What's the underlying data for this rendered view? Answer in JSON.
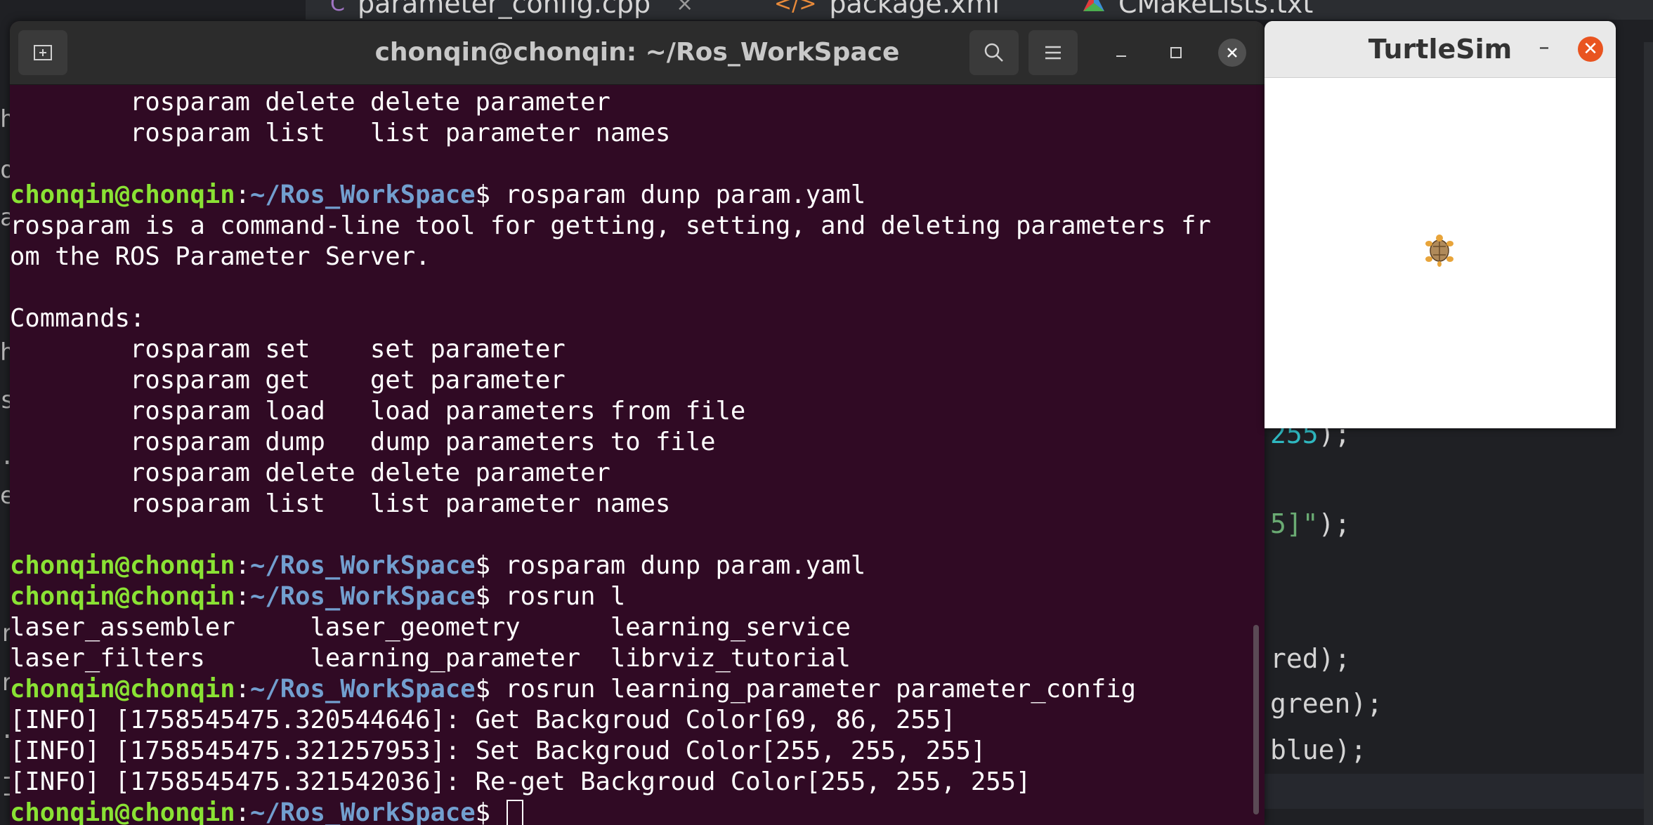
{
  "editor": {
    "tabs": [
      {
        "label": "parameter_config.cpp",
        "icon": "cpp-file-icon"
      },
      {
        "label": "package.xml",
        "icon": "xml-file-icon"
      },
      {
        "label": "CMakeLists.txt",
        "icon": "cmake-icon"
      }
    ],
    "tab_close": "×",
    "code_fragments": [
      {
        "text": "255",
        "tail": ");"
      },
      {
        "text": "5]\"",
        "tail": ");"
      },
      {
        "text": "red);"
      },
      {
        "text": "green);"
      },
      {
        "text": "blue);"
      }
    ],
    "gutter_glyphs": [
      "h",
      "o",
      "a",
      "h",
      "s",
      ".",
      "e",
      "r",
      "r",
      ".",
      "-",
      "-"
    ]
  },
  "terminal": {
    "title": "chonqin@chonqin: ~/Ros_WorkSpace",
    "prompt_user": "chonqin@chonqin",
    "prompt_sep": ":",
    "prompt_path": "~/Ros_WorkSpace",
    "prompt_end": "$",
    "lines": [
      {
        "text": "        rosparam delete delete parameter"
      },
      {
        "text": "        rosparam list   list parameter names"
      },
      {
        "text": ""
      },
      {
        "prompt": true,
        "cmd": " rosparam dunp param.yaml"
      },
      {
        "text": "rosparam is a command-line tool for getting, setting, and deleting parameters fr"
      },
      {
        "text": "om the ROS Parameter Server."
      },
      {
        "text": ""
      },
      {
        "text": "Commands:"
      },
      {
        "text": "        rosparam set    set parameter"
      },
      {
        "text": "        rosparam get    get parameter"
      },
      {
        "text": "        rosparam load   load parameters from file"
      },
      {
        "text": "        rosparam dump   dump parameters to file"
      },
      {
        "text": "        rosparam delete delete parameter"
      },
      {
        "text": "        rosparam list   list parameter names"
      },
      {
        "text": ""
      },
      {
        "prompt": true,
        "cmd": " rosparam dunp param.yaml"
      },
      {
        "prompt": true,
        "cmd": " rosrun l"
      },
      {
        "text": "laser_assembler     laser_geometry      learning_service"
      },
      {
        "text": "laser_filters       learning_parameter  librviz_tutorial"
      },
      {
        "prompt": true,
        "cmd": " rosrun learning_parameter parameter_config"
      },
      {
        "text": "[INFO] [1758545475.320544646]: Get Backgroud Color[69, 86, 255]"
      },
      {
        "text": "[INFO] [1758545475.321257953]: Set Backgroud Color[255, 255, 255]"
      },
      {
        "text": "[INFO] [1758545475.321542036]: Re-get Backgroud Color[255, 255, 255]"
      },
      {
        "prompt": true,
        "cmd": " ",
        "cursor": true
      }
    ],
    "colors": {
      "background": "#300a24",
      "user": "#8ae234",
      "path": "#729fcf"
    }
  },
  "turtlesim": {
    "title": "TurtleSim",
    "minimize": "–",
    "close": "✕",
    "canvas_color": "#ffffff"
  }
}
